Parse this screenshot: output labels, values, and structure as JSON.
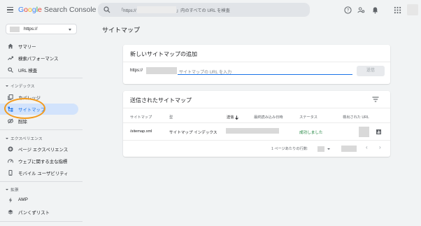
{
  "header": {
    "logo_google": [
      "G",
      "o",
      "o",
      "g",
      "l",
      "e"
    ],
    "logo_product": "Search Console",
    "search_prefix": "「https://",
    "search_suffix": "」内のすべての URL を検査"
  },
  "sidebar": {
    "property": "https://",
    "items": [
      {
        "label": "サマリー",
        "icon": "home-icon"
      },
      {
        "label": "検索パフォーマンス",
        "icon": "trending-up-icon"
      },
      {
        "label": "URL 検査",
        "icon": "search-icon"
      }
    ],
    "section_index": "インデックス",
    "index_items": [
      {
        "label": "カバレッジ",
        "icon": "file-copy-icon"
      },
      {
        "label": "サイトマップ",
        "icon": "sitemap-icon"
      },
      {
        "label": "削除",
        "icon": "visibility-off-icon"
      }
    ],
    "section_experience": "エクスペリエンス",
    "experience_items": [
      {
        "label": "ページ エクスペリエンス",
        "icon": "add-circle-icon"
      },
      {
        "label": "ウェブに関する主な指標",
        "icon": "speed-icon"
      },
      {
        "label": "モバイル ユーザビリティ",
        "icon": "phone-icon"
      }
    ],
    "section_enhancements": "拡張",
    "enhancement_items": [
      {
        "label": "AMP",
        "icon": "flash-icon"
      },
      {
        "label": "パンくずリスト",
        "icon": "layers-icon"
      }
    ]
  },
  "main": {
    "page_title": "サイトマップ",
    "add_card": {
      "title": "新しいサイトマップの追加",
      "prefix": "https://",
      "placeholder": "サイトマップの URL を入力",
      "submit_label": "送信"
    },
    "submitted_card": {
      "title": "送信されたサイトマップ",
      "columns": [
        "サイトマップ",
        "型",
        "送信",
        "最終読み込み日時",
        "ステータス",
        "検出された URL"
      ],
      "rows": [
        {
          "sitemap": "/sitemap.xml",
          "type": "サイトマップ インデックス",
          "status": "成功しました"
        }
      ],
      "rows_per_page_label": "1 ページあたりの行数:"
    }
  },
  "colors": {
    "accent": "#1a73e8",
    "active_bg": "#d2e3fc",
    "success": "#188038",
    "highlight": "#f29a1d"
  }
}
